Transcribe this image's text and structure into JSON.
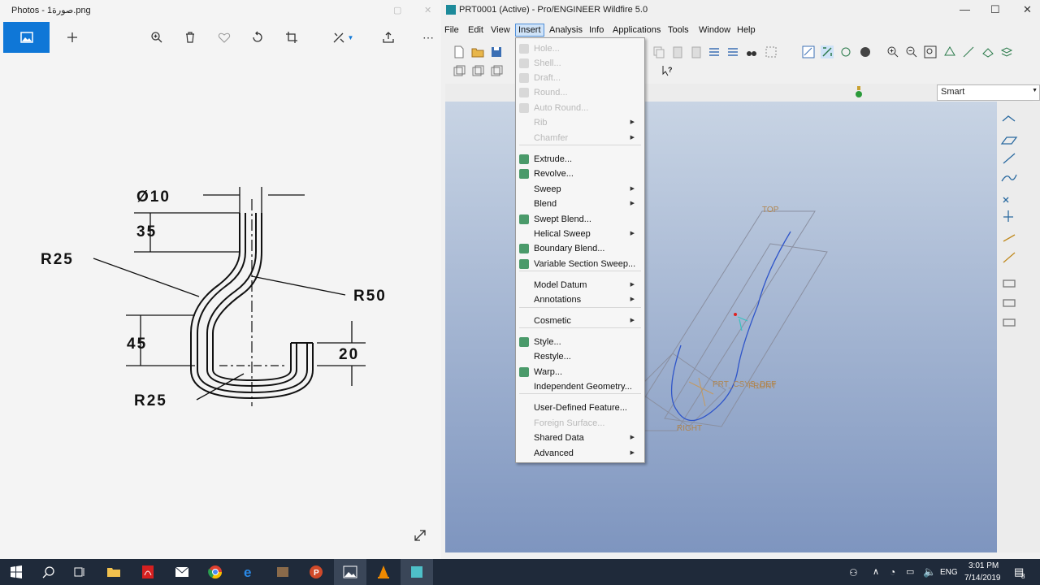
{
  "photos": {
    "title": "Photos - صورة1.png",
    "toolbar_icons": [
      "image-icon",
      "plus-icon",
      "zoom-icon",
      "delete-icon",
      "heart-icon",
      "rotate-icon",
      "crop-icon",
      "edit-icon",
      "share-icon",
      "more-icon"
    ],
    "drawing": {
      "dia": "Ø10",
      "d35": "35",
      "r25_top": "R25",
      "r50": "R50",
      "d45": "45",
      "d20": "20",
      "r25_bottom": "R25"
    }
  },
  "proe": {
    "title": "PRT0001 (Active) - Pro/ENGINEER Wildfire 5.0",
    "menu": [
      "File",
      "Edit",
      "View",
      "Insert",
      "Analysis",
      "Info",
      "Applications",
      "Tools",
      "Window",
      "Help"
    ],
    "active_menu": "Insert",
    "filter_value": "Smart",
    "viewport_labels": {
      "top": "TOP",
      "csys": "PRT_CSYS_DEF",
      "front": "FRONT",
      "right": "RIGHT"
    }
  },
  "insert_menu": [
    {
      "label": "Hole...",
      "disabled": true,
      "arrow": false
    },
    {
      "label": "Shell...",
      "disabled": true,
      "arrow": false
    },
    {
      "label": "Draft...",
      "disabled": true,
      "arrow": false
    },
    {
      "label": "Round...",
      "disabled": true,
      "arrow": false
    },
    {
      "label": "Auto Round...",
      "disabled": true,
      "arrow": false
    },
    {
      "label": "Rib",
      "disabled": true,
      "arrow": true
    },
    {
      "label": "Chamfer",
      "disabled": true,
      "arrow": true
    },
    {
      "label": "Extrude...",
      "disabled": false,
      "arrow": false
    },
    {
      "label": "Revolve...",
      "disabled": false,
      "arrow": false
    },
    {
      "label": "Sweep",
      "disabled": false,
      "arrow": true
    },
    {
      "label": "Blend",
      "disabled": false,
      "arrow": true
    },
    {
      "label": "Swept Blend...",
      "disabled": false,
      "arrow": false
    },
    {
      "label": "Helical Sweep",
      "disabled": false,
      "arrow": true
    },
    {
      "label": "Boundary Blend...",
      "disabled": false,
      "arrow": false
    },
    {
      "label": "Variable Section Sweep...",
      "disabled": false,
      "arrow": false
    },
    {
      "label": "Model Datum",
      "disabled": false,
      "arrow": true
    },
    {
      "label": "Annotations",
      "disabled": false,
      "arrow": true
    },
    {
      "label": "Cosmetic",
      "disabled": false,
      "arrow": true
    },
    {
      "label": "Style...",
      "disabled": false,
      "arrow": false
    },
    {
      "label": "Restyle...",
      "disabled": false,
      "arrow": false
    },
    {
      "label": "Warp...",
      "disabled": false,
      "arrow": false
    },
    {
      "label": "Independent Geometry...",
      "disabled": false,
      "arrow": false
    },
    {
      "label": "User-Defined Feature...",
      "disabled": false,
      "arrow": false
    },
    {
      "label": "Foreign Surface...",
      "disabled": true,
      "arrow": false
    },
    {
      "label": "Shared Data",
      "disabled": false,
      "arrow": true
    },
    {
      "label": "Advanced",
      "disabled": false,
      "arrow": true
    }
  ],
  "taskbar": {
    "lang": "ENG",
    "time": "3:01 PM",
    "date": "7/14/2019",
    "notif_count": "8"
  },
  "colors": {
    "accent": "#0f77d7",
    "taskbar": "#1f2a3a",
    "viewport_top": "#c8d4e4",
    "viewport_bottom": "#7e95bf"
  }
}
